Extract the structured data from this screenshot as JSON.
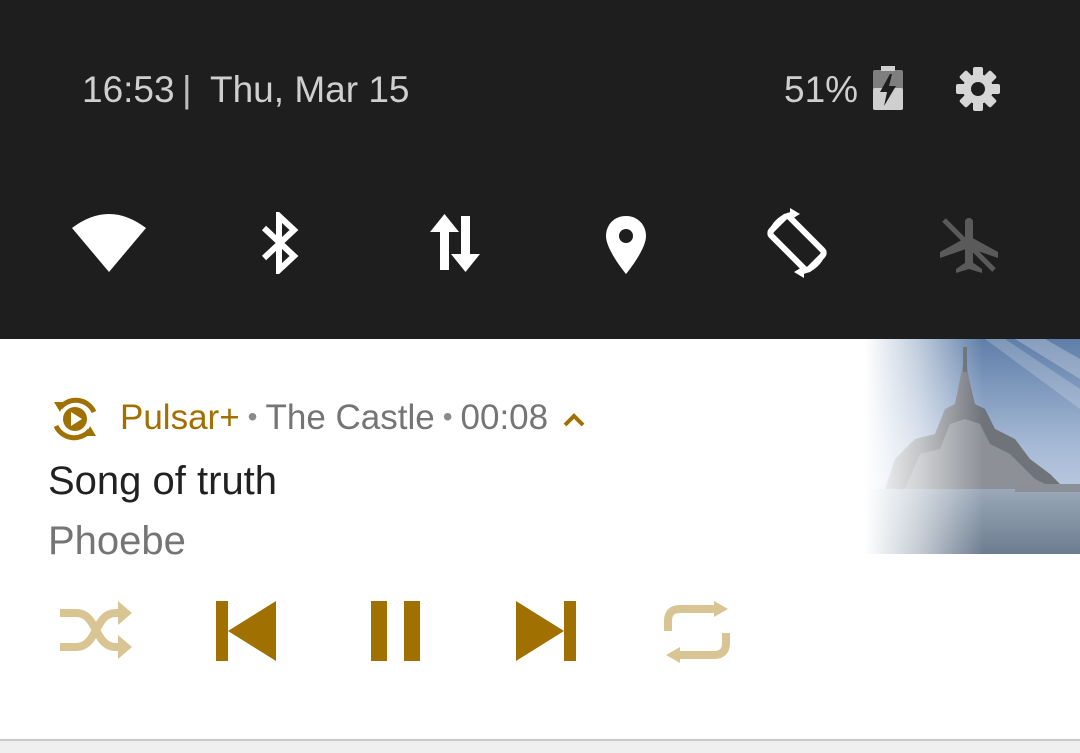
{
  "status_bar": {
    "time": "16:53",
    "separator": "|",
    "date": "Thu, Mar 15",
    "battery_percent": "51%"
  },
  "icons": {
    "battery": "battery-charging-icon",
    "settings": "gear-icon",
    "wifi": "wifi-icon",
    "bluetooth": "bluetooth-icon",
    "mobile_data": "mobile-data-icon",
    "location": "location-icon",
    "rotation": "auto-rotate-icon",
    "airplane": "airplane-mode-icon"
  },
  "notification": {
    "app_name": "Pulsar+",
    "dot": "•",
    "album": "The Castle",
    "elapsed": "00:08",
    "song_title": "Song of truth",
    "artist": "Phoebe",
    "controls": [
      "shuffle-icon",
      "previous-icon",
      "pause-icon",
      "next-icon",
      "repeat-icon"
    ]
  },
  "colors": {
    "accent": "#a07000",
    "accent_dim": "#d9c593",
    "panel_bg": "#1e1e1e",
    "icon_active": "#ffffff",
    "icon_inactive": "#5a5a5a"
  }
}
